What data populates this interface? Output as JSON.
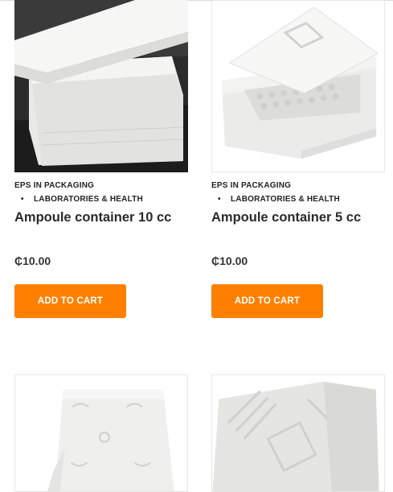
{
  "products": [
    {
      "category": "EPS IN PACKAGING",
      "subcategory": "LABORATORIES & HEALTH",
      "title": "Ampoule container 10 cc",
      "price": "₵10.00",
      "button": "ADD TO CART",
      "image": "white-eps-box-dark-background"
    },
    {
      "category": "EPS IN PACKAGING",
      "subcategory": "LABORATORIES & HEALTH",
      "title": "Ampoule container 5 cc",
      "price": "₵10.00",
      "button": "ADD TO CART",
      "image": "white-eps-box-light-background"
    }
  ],
  "next_row": [
    {
      "image": "white-ornate-tile"
    },
    {
      "image": "white-diagonal-pattern-tile"
    }
  ],
  "colors": {
    "button": "#ff8000",
    "button_text": "#ffffff",
    "text": "#2a2a2a"
  }
}
